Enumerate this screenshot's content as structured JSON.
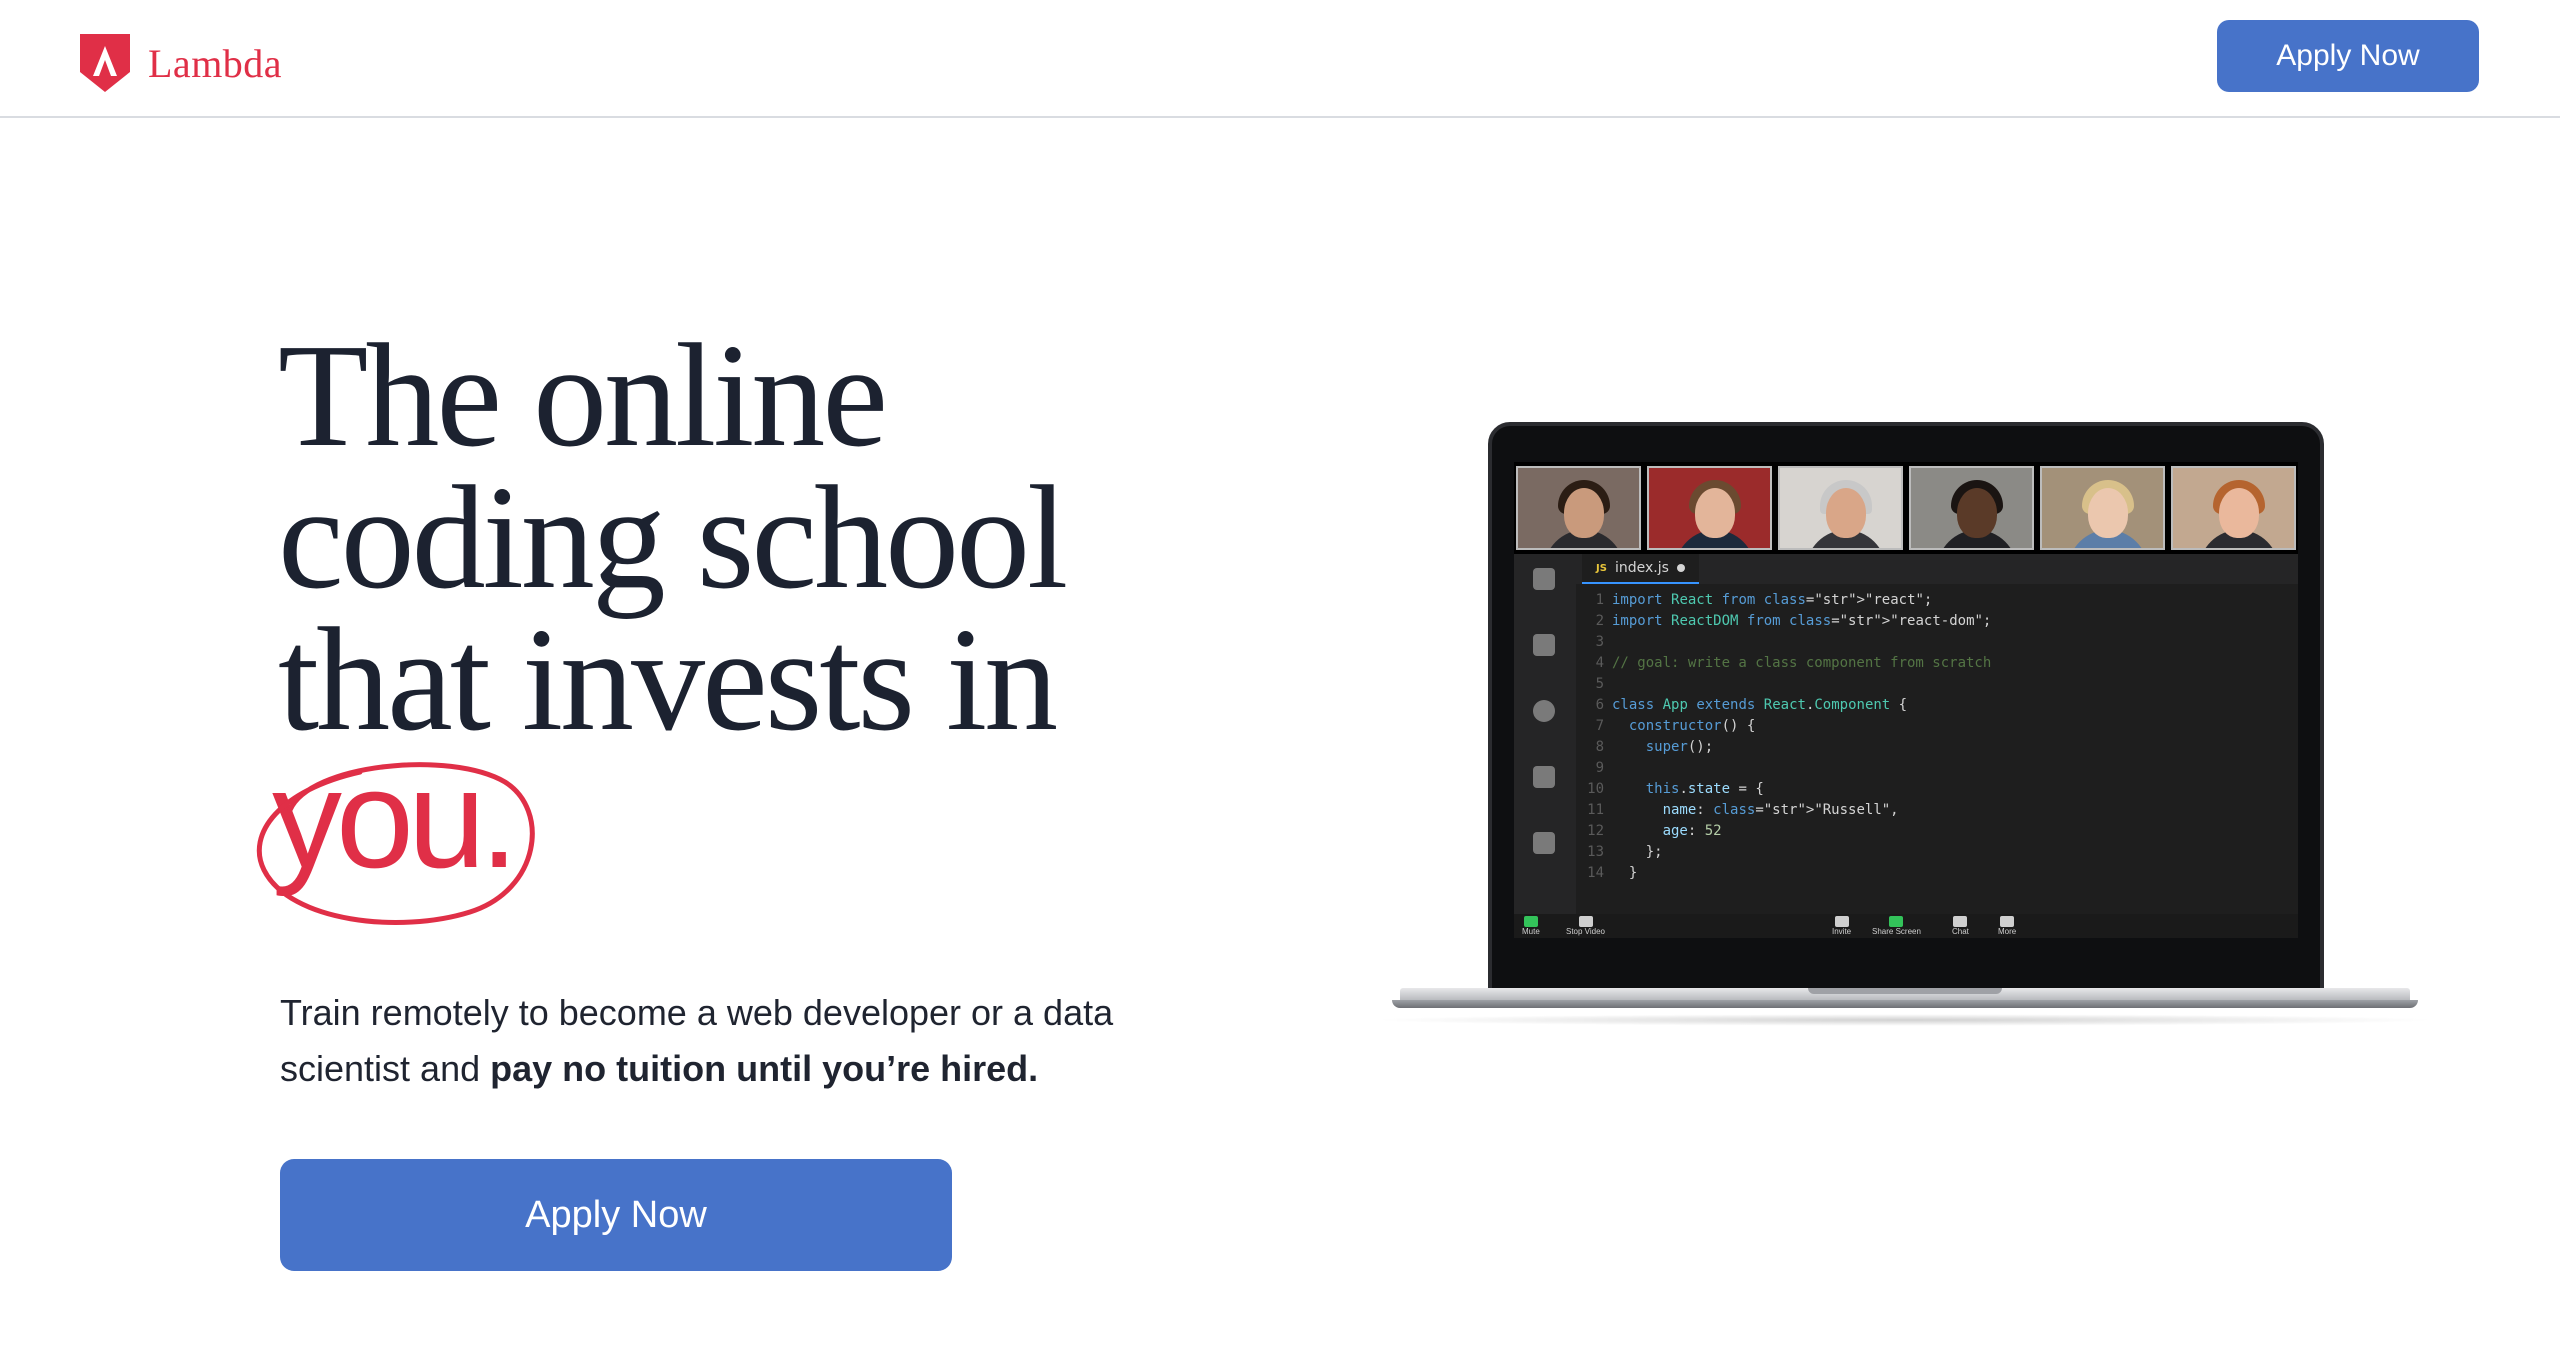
{
  "header": {
    "logo_text": "Lambda",
    "apply_label": "Apply Now"
  },
  "hero": {
    "title_lines": [
      "The online",
      "coding school",
      "that invests in"
    ],
    "highlight_word": "you.",
    "subtext_plain": "Train remotely to become a web developer or a data scientist and ",
    "subtext_bold": "pay no tuition until you’re hired.",
    "apply_label": "Apply Now"
  },
  "laptop": {
    "tab_label": "index.js",
    "tab_lang": "JS",
    "code_lines": [
      {
        "n": "1",
        "text": "import React from \"react\";"
      },
      {
        "n": "2",
        "text": "import ReactDOM from \"react-dom\";"
      },
      {
        "n": "3",
        "text": ""
      },
      {
        "n": "4",
        "text": "// goal: write a class component from scratch"
      },
      {
        "n": "5",
        "text": ""
      },
      {
        "n": "6",
        "text": "class App extends React.Component {"
      },
      {
        "n": "7",
        "text": "  constructor() {"
      },
      {
        "n": "8",
        "text": "    super();"
      },
      {
        "n": "9",
        "text": ""
      },
      {
        "n": "10",
        "text": "    this.state = {"
      },
      {
        "n": "11",
        "text": "      name: \"Russell\","
      },
      {
        "n": "12",
        "text": "      age: 52"
      },
      {
        "n": "13",
        "text": "    };"
      },
      {
        "n": "14",
        "text": "  }"
      }
    ],
    "zoom_controls": [
      "Mute",
      "Stop Video",
      "Invite",
      "Share Screen",
      "Chat",
      "More"
    ]
  },
  "colors": {
    "brand_red": "#e02f47",
    "button_blue": "#4773c9",
    "heading": "#1c2230"
  },
  "icons": [
    "lambda-shield-icon",
    "explorer-icon",
    "file-icon",
    "github-icon",
    "rocket-icon",
    "settings-file-icon",
    "microphone-icon",
    "video-camera-icon",
    "invite-icon",
    "share-screen-icon",
    "chat-icon",
    "more-icon"
  ]
}
